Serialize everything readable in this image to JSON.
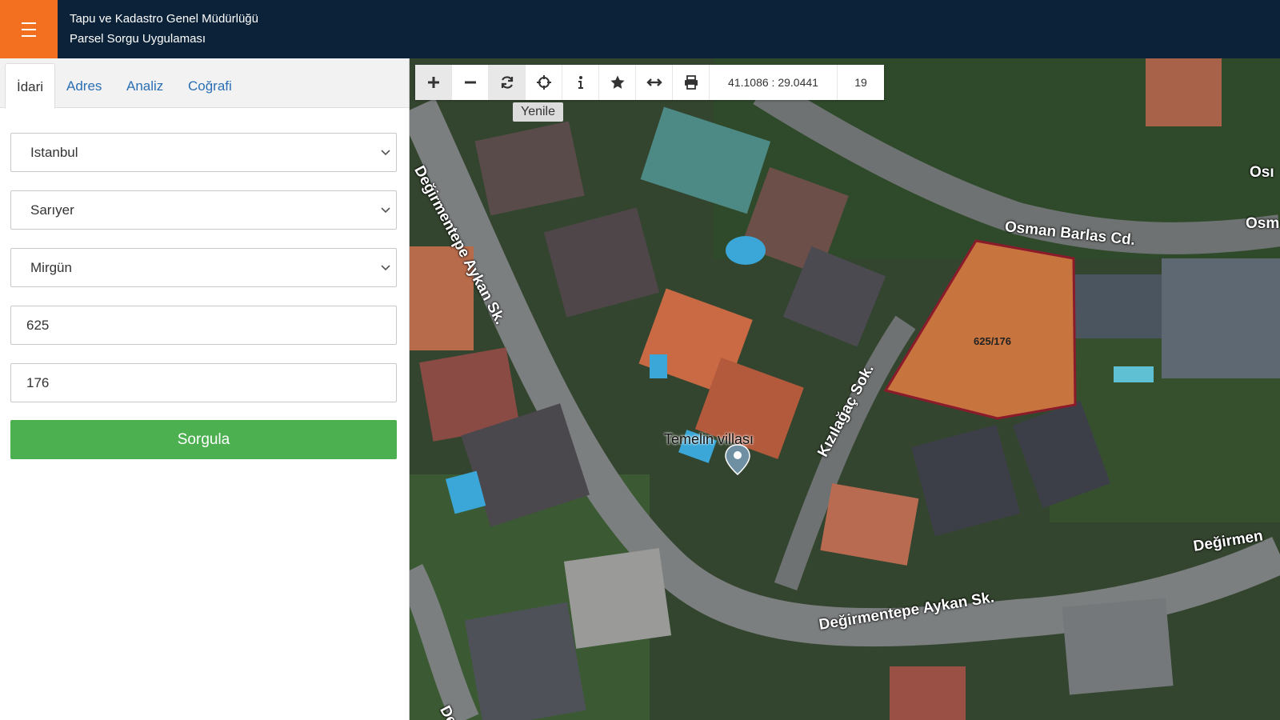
{
  "header": {
    "title": "Tapu ve Kadastro Genel Müdürlüğü",
    "subtitle": "Parsel Sorgu Uygulaması",
    "menu_icon": "hamburger-icon",
    "accent": "#f37021",
    "bg": "#0b2239"
  },
  "tabs": [
    {
      "label": "İdari",
      "active": true
    },
    {
      "label": "Adres",
      "active": false
    },
    {
      "label": "Analiz",
      "active": false
    },
    {
      "label": "Coğrafi",
      "active": false
    }
  ],
  "form": {
    "province": "Istanbul",
    "district": "Sarıyer",
    "neighborhood": "Mirgün",
    "block": "625",
    "parcel": "176",
    "submit_label": "Sorgula",
    "submit_color": "#4caf50"
  },
  "toolbar": {
    "tools": [
      "plus-icon",
      "minus-icon",
      "refresh-icon",
      "crosshair-icon",
      "info-icon",
      "star-icon",
      "measure-icon",
      "print-icon"
    ],
    "coordinates": "41.1086 : 29.0441",
    "zoom": "19",
    "tooltip": "Yenile"
  },
  "map": {
    "parcel_label": "625/176",
    "parcel_color": "#8b1a2b",
    "poi_label": "Temelin villası",
    "streets": {
      "s1": "Osman Barlas Cd.",
      "s2": "Osm",
      "s3": "Osı",
      "s4": "Değirmentepe Aykan Sk.",
      "s5": "Kızılağaç Sok.",
      "s6": "Değirmentepe Aykan Sk.",
      "s7": "Değirmen",
      "s8": "De"
    }
  }
}
